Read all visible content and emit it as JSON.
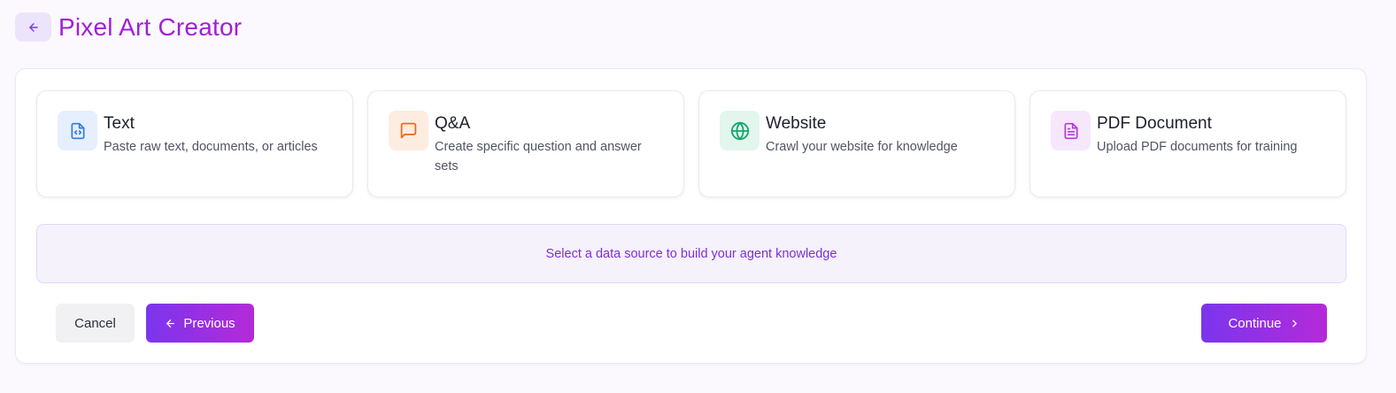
{
  "header": {
    "title": "Pixel Art Creator",
    "back_icon": "arrow-left-icon"
  },
  "sources": [
    {
      "title": "Text",
      "description": "Paste raw text, documents, or articles",
      "icon": "file-code-icon",
      "icon_bg": "#e6effe",
      "icon_color": "#2f7be8"
    },
    {
      "title": "Q&A",
      "description": "Create specific question and answer sets",
      "icon": "message-square-icon",
      "icon_bg": "#fdece0",
      "icon_color": "#ea6a1c"
    },
    {
      "title": "Website",
      "description": "Crawl your website for knowledge",
      "icon": "globe-icon",
      "icon_bg": "#e2f6ee",
      "icon_color": "#16a66e"
    },
    {
      "title": "PDF Document",
      "description": "Upload PDF documents for training",
      "icon": "file-text-icon",
      "icon_bg": "#f6e7fd",
      "icon_color": "#b43ad9"
    }
  ],
  "notice": "Select a data source to build your agent knowledge",
  "actions": {
    "cancel": "Cancel",
    "previous": "Previous",
    "continue": "Continue"
  },
  "colors": {
    "accent": "#a21fd6",
    "primary_gradient_start": "#7b35ee",
    "primary_gradient_end": "#b42ad8"
  }
}
